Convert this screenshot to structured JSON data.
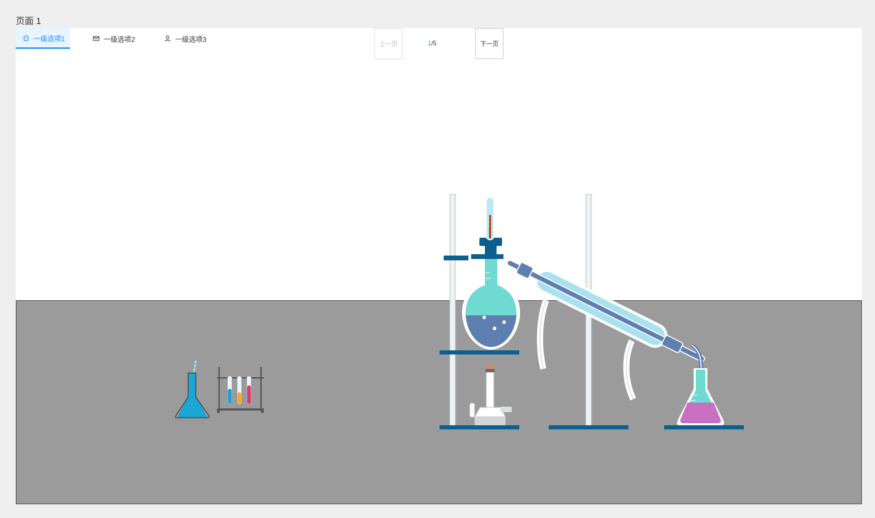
{
  "page": {
    "label": "页面 1"
  },
  "menu": {
    "items": [
      {
        "label": "一级选项1",
        "icon": "home-icon",
        "active": true
      },
      {
        "label": "一级选项2",
        "icon": "mail-icon",
        "active": false
      },
      {
        "label": "一级选项3",
        "icon": "user-icon",
        "active": false
      }
    ]
  },
  "pager": {
    "prev_label": "上一页",
    "next_label": "下一页",
    "current": "1",
    "total": "/5"
  },
  "colors": {
    "accent": "#1890ff",
    "table": "#9b9b9b",
    "stand_blue": "#0d5f8e",
    "liquid_teal": "#6fdad2",
    "liquid_blue": "#5e7fb0",
    "liquid_pink": "#c86fc2",
    "condenser": "#a9e2ee"
  }
}
